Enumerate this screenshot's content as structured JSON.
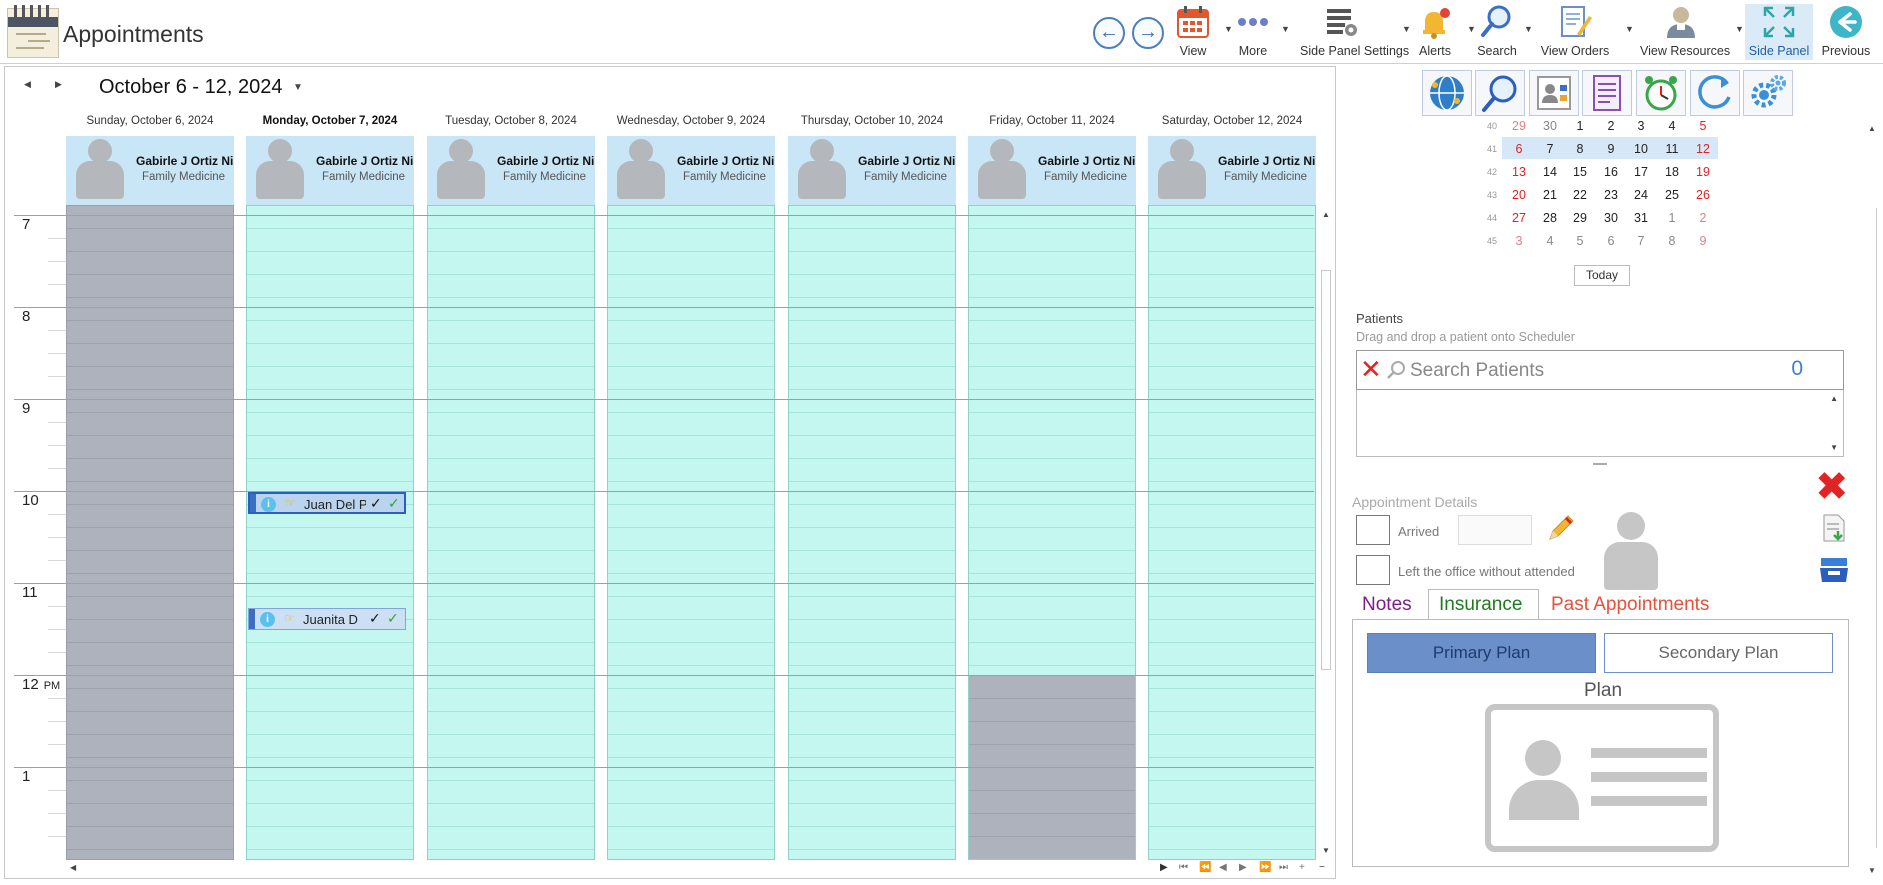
{
  "header": {
    "title": "Appointments",
    "toolbar": [
      {
        "id": "view",
        "label": "View",
        "icon": "calendar-icon"
      },
      {
        "id": "more",
        "label": "More",
        "icon": "more-dots-icon"
      },
      {
        "id": "side-panel-settings",
        "label": "Side Panel Settings",
        "icon": "panel-settings-icon"
      },
      {
        "id": "alerts",
        "label": "Alerts",
        "icon": "bell-icon"
      },
      {
        "id": "search",
        "label": "Search",
        "icon": "magnifier-icon"
      },
      {
        "id": "view-orders",
        "label": "View Orders",
        "icon": "orders-icon"
      },
      {
        "id": "view-resources",
        "label": "View Resources",
        "icon": "resources-icon"
      },
      {
        "id": "side-panel",
        "label": "Side Panel",
        "icon": "expand-icon",
        "active": true
      },
      {
        "id": "previous",
        "label": "Previous",
        "icon": "back-circle-icon"
      }
    ]
  },
  "calendar": {
    "range_label": "October 6 - 12, 2024",
    "days": [
      {
        "label": "Sunday, October 6, 2024",
        "off": true
      },
      {
        "label": "Monday, October 7, 2024",
        "today": true
      },
      {
        "label": "Tuesday, October 8, 2024"
      },
      {
        "label": "Wednesday, October 9, 2024"
      },
      {
        "label": "Thursday, October 10, 2024"
      },
      {
        "label": "Friday, October 11, 2024"
      },
      {
        "label": "Saturday, October 12, 2024"
      }
    ],
    "resource": {
      "name": "Gabirle J Ortiz Ni",
      "specialty": "Family Medicine"
    },
    "hours": [
      {
        "label": "7",
        "ampm": ""
      },
      {
        "label": "8",
        "ampm": ""
      },
      {
        "label": "9",
        "ampm": ""
      },
      {
        "label": "10",
        "ampm": ""
      },
      {
        "label": "11",
        "ampm": ""
      },
      {
        "label": "12",
        "ampm": "PM"
      },
      {
        "label": "1",
        "ampm": ""
      }
    ],
    "appointments": [
      {
        "patient": "Juan Del P",
        "selected": true
      },
      {
        "patient": "Juanita D",
        "selected": false
      }
    ]
  },
  "side_panel": {
    "mini_calendar": {
      "weeks": [
        {
          "week": "40",
          "days": [
            "29",
            "30",
            "1",
            "2",
            "3",
            "4",
            "5"
          ]
        },
        {
          "week": "41",
          "days": [
            "6",
            "7",
            "8",
            "9",
            "10",
            "11",
            "12"
          ]
        },
        {
          "week": "42",
          "days": [
            "13",
            "14",
            "15",
            "16",
            "17",
            "18",
            "19"
          ]
        },
        {
          "week": "43",
          "days": [
            "20",
            "21",
            "22",
            "23",
            "24",
            "25",
            "26"
          ]
        },
        {
          "week": "44",
          "days": [
            "27",
            "28",
            "29",
            "30",
            "31",
            "1",
            "2"
          ]
        },
        {
          "week": "45",
          "days": [
            "3",
            "4",
            "5",
            "6",
            "7",
            "8",
            "9"
          ]
        }
      ],
      "today_label": "Today"
    },
    "patients": {
      "label": "Patients",
      "hint": "Drag and drop a patient onto Scheduler",
      "search_placeholder": "Search Patients",
      "count": "0"
    },
    "appointment_details": {
      "label": "Appointment Details",
      "arrived_label": "Arrived",
      "left_label": "Left the office without attended"
    },
    "tabs": [
      {
        "label": "Notes",
        "color": "#7b1f8a"
      },
      {
        "label": "Insurance",
        "color": "#1e7a1e"
      },
      {
        "label": "Past Appointments",
        "color": "#e8503a"
      }
    ],
    "insurance": {
      "primary_label": "Primary Plan",
      "secondary_label": "Secondary Plan",
      "plan_title": "Plan"
    }
  },
  "colors": {
    "accent": "#3a6fc4",
    "available_slot": "#c4f7ef",
    "unavailable_slot": "#adb2bd",
    "resource_header": "#c9e6f7"
  }
}
